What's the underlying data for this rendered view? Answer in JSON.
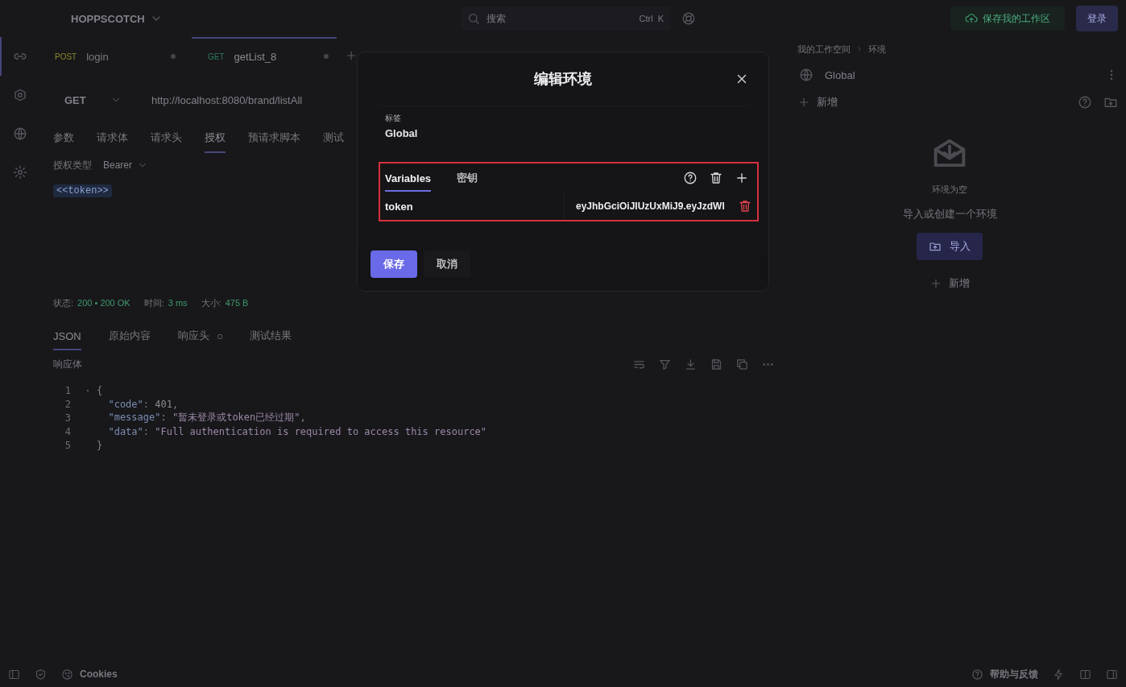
{
  "topbar": {
    "brand": "HOPPSCOTCH",
    "search": {
      "placeholder": "搜索",
      "keys": [
        "Ctrl",
        "K"
      ]
    },
    "save_workspace": "保存我的工作区",
    "login": "登录"
  },
  "rail": [
    {
      "kind": "rest",
      "selected": true
    },
    {
      "kind": "graphql",
      "selected": false
    },
    {
      "kind": "realtime",
      "selected": false
    },
    {
      "kind": "settings",
      "selected": false
    }
  ],
  "request_tabs": [
    {
      "method": "POST",
      "color": "#8a8a2a",
      "name": "login",
      "selected": false
    },
    {
      "method": "GET",
      "color": "#2f7a5a",
      "name": "getList_8",
      "selected": true
    }
  ],
  "url_bar": {
    "method": "GET",
    "url": "http://localhost:8080/brand/listAll"
  },
  "request_sections": [
    {
      "label": "参数",
      "selected": false
    },
    {
      "label": "请求体",
      "selected": false
    },
    {
      "label": "请求头",
      "selected": false
    },
    {
      "label": "授权",
      "selected": true
    },
    {
      "label": "预请求脚本",
      "selected": false
    },
    {
      "label": "测试",
      "selected": false
    }
  ],
  "auth": {
    "label": "授权类型",
    "value": "Bearer",
    "token": "<<token>>"
  },
  "response_meta": [
    {
      "label": "状态:",
      "value": "200 • 200 OK"
    },
    {
      "label": "时间:",
      "value": "3 ms"
    },
    {
      "label": "大小:",
      "value": "475 B"
    }
  ],
  "response_tabs": [
    {
      "label": "JSON",
      "selected": true,
      "dot": false
    },
    {
      "label": "原始内容",
      "selected": false,
      "dot": false
    },
    {
      "label": "响应头",
      "selected": false,
      "dot": true
    },
    {
      "label": "测试结果",
      "selected": false,
      "dot": false
    }
  ],
  "response_body": {
    "label": "响应体",
    "lines": [
      {
        "number": "1",
        "parts": [
          {
            "kind": "punct",
            "text": "{"
          }
        ]
      },
      {
        "number": "2",
        "parts": [
          {
            "kind": "key",
            "text": "  \"code\""
          },
          {
            "kind": "punct",
            "text": ": "
          },
          {
            "kind": "number",
            "text": "401"
          },
          {
            "kind": "punct",
            "text": ","
          }
        ]
      },
      {
        "number": "3",
        "parts": [
          {
            "kind": "key",
            "text": "  \"message\""
          },
          {
            "kind": "punct",
            "text": ": "
          },
          {
            "kind": "string",
            "text": "\"暂未登录或token已经过期\""
          },
          {
            "kind": "punct",
            "text": ","
          }
        ]
      },
      {
        "number": "4",
        "parts": [
          {
            "kind": "key",
            "text": "  \"data\""
          },
          {
            "kind": "punct",
            "text": ": "
          },
          {
            "kind": "string",
            "text": "\"Full authentication is required to access this resource\""
          }
        ]
      },
      {
        "number": "5",
        "parts": [
          {
            "kind": "punct",
            "text": "}"
          }
        ]
      }
    ]
  },
  "environments": {
    "breadcrumb": [
      "我的工作空间",
      "环境"
    ],
    "items": [
      {
        "name": "Global"
      }
    ],
    "add": "新增",
    "empty": {
      "title": "环境为空",
      "hint": "导入或创建一个环境",
      "import": "导入",
      "add": "新增"
    }
  },
  "footer": {
    "cookies": "Cookies",
    "help": "帮助与反馈"
  },
  "modal": {
    "title": "编辑环境",
    "label_caption": "标签",
    "label_value": "Global",
    "tabs": [
      {
        "label": "Variables",
        "selected": true
      },
      {
        "label": "密钥",
        "selected": false
      }
    ],
    "variables": [
      {
        "name": "token",
        "value": "eyJhbGciOiJIUzUxMiJ9.eyJzdWI"
      }
    ],
    "save": "保存",
    "cancel": "取消"
  }
}
